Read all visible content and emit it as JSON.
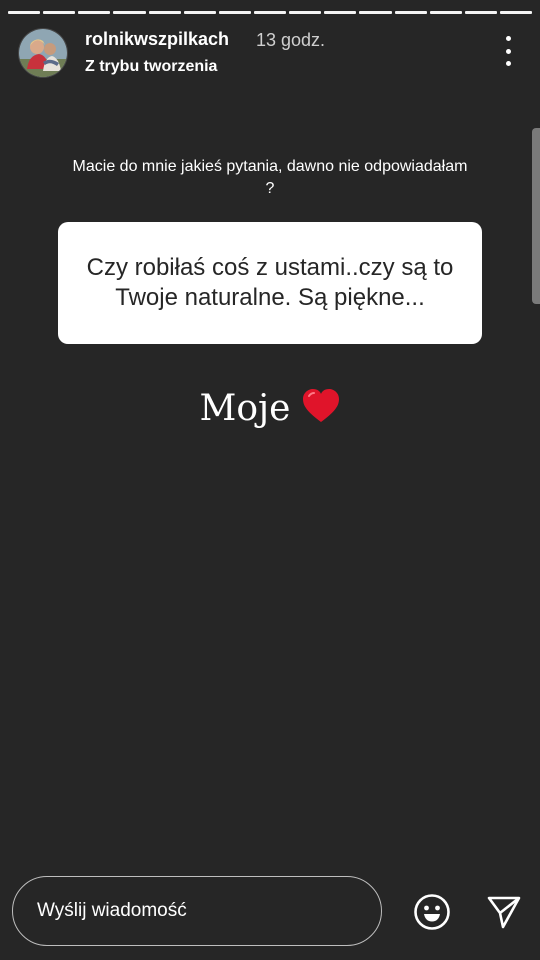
{
  "story": {
    "progress": {
      "segments": 15,
      "current": 15
    },
    "header": {
      "username": "rolnikwszpilkach",
      "timestamp": "13 godz.",
      "mode_label": "Z trybu tworzenia"
    },
    "question_sticker": {
      "prompt": "Macie do mnie jakieś pytania, dawno nie odpowiadałam ?",
      "question": "Czy robiłaś coś z ustami..czy są to Twoje naturalne. Są piękne..."
    },
    "answer": {
      "text": "Moje"
    },
    "footer": {
      "message_placeholder": "Wyślij wiadomość"
    },
    "icons": {
      "more": "more-vertical-icon",
      "answer_emoji": "red-heart-icon",
      "emoji": "smiley-icon",
      "send": "paper-plane-icon"
    },
    "colors": {
      "background": "#262626",
      "card": "#ffffff",
      "heart": "#e0142a"
    }
  }
}
